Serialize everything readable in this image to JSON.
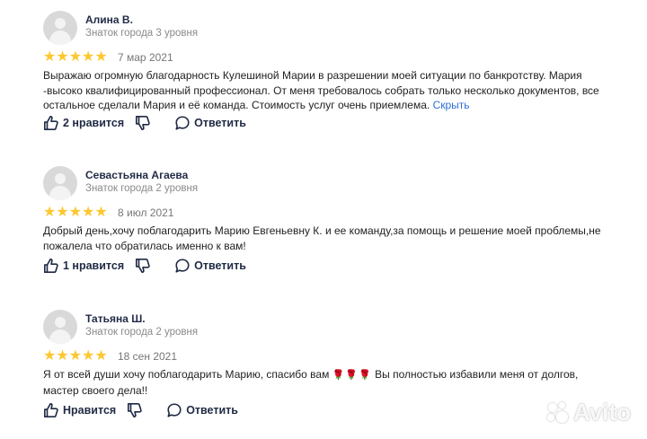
{
  "reviews": [
    {
      "name": "Алина В.",
      "level": "Знаток города 3 уровня",
      "rating": 5,
      "date": "7 мар 2021",
      "text_lines": [
        "Выражаю огромную благодарность Кулешиной Марии в разрешении моей ситуации по банкротству. Мария",
        "-высоко квалифицированный профессионал. От меня требовалось собрать только несколько документов, все",
        "остальное сделали Мария и её команда. Стоимость услуг очень приемлема."
      ],
      "more_label": "Скрыть",
      "like_label": "2 нравится",
      "reply_label": "Ответить"
    },
    {
      "name": "Севастьяна Агаева",
      "level": "Знаток города 2 уровня",
      "rating": 5,
      "date": "8 июл 2021",
      "text_lines": [
        "Добрый день,хочу поблагодарить Марию Евгеньевну К. и ее команду,за помощь и решение моей проблемы,не",
        "пожалела что обратилась именно к вам!"
      ],
      "like_label": "1 нравится",
      "reply_label": "Ответить"
    },
    {
      "name": "Татьяна Ш.",
      "level": "Знаток города 2 уровня",
      "rating": 5,
      "date": "18 сен 2021",
      "text_line1_a": "Я от всей души хочу поблагодарить Марию, спасибо вам",
      "text_emoji": "🌹🌹🌹",
      "text_line1_b": "Вы полностью избавили меня от долгов,",
      "text_line2": "мастер своего дела!!",
      "like_label": "Нравится",
      "reply_label": "Ответить"
    }
  ],
  "icons": {
    "like": "thumbs-up-icon",
    "dislike": "thumbs-down-icon",
    "reply": "speech-bubble-icon",
    "star": "star-icon",
    "avatar": "user-avatar-icon"
  },
  "colors": {
    "star": "#fdc72f",
    "link": "#2e6fd6",
    "action": "#1f2a44",
    "muted": "#8a8a8a"
  },
  "watermark": "Avito"
}
